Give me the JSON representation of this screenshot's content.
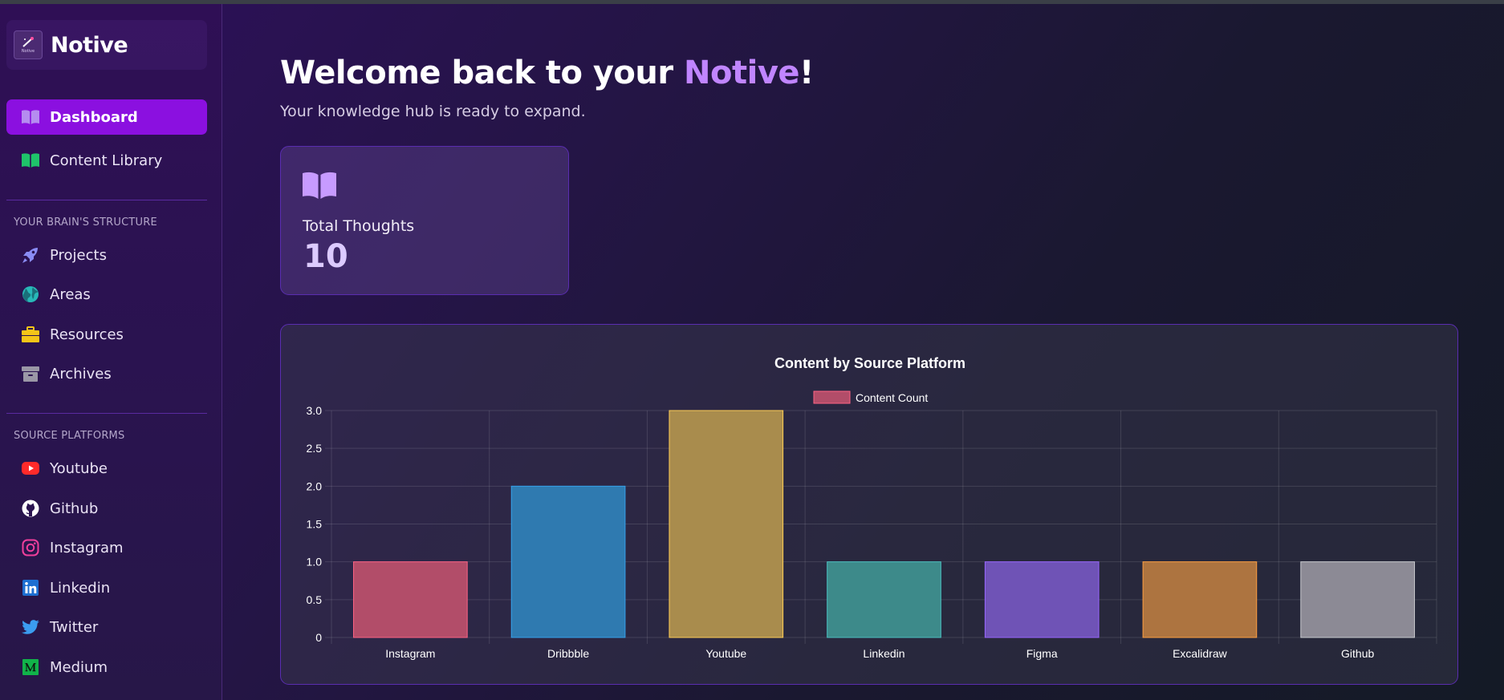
{
  "brand": {
    "name": "Notive",
    "logo_caption": "Notive"
  },
  "nav": {
    "main": [
      {
        "label": "Dashboard",
        "icon": "book-open-icon",
        "active": true
      },
      {
        "label": "Content Library",
        "icon": "book-icon",
        "active": false
      }
    ],
    "structure_label": "YOUR BRAIN'S STRUCTURE",
    "structure": [
      {
        "label": "Projects",
        "icon": "rocket-icon"
      },
      {
        "label": "Areas",
        "icon": "globe-icon"
      },
      {
        "label": "Resources",
        "icon": "briefcase-icon"
      },
      {
        "label": "Archives",
        "icon": "archive-icon"
      }
    ],
    "platforms_label": "SOURCE PLATFORMS",
    "platforms": [
      {
        "label": "Youtube",
        "icon": "youtube-icon"
      },
      {
        "label": "Github",
        "icon": "github-icon"
      },
      {
        "label": "Instagram",
        "icon": "instagram-icon"
      },
      {
        "label": "Linkedin",
        "icon": "linkedin-icon"
      },
      {
        "label": "Twitter",
        "icon": "twitter-icon"
      },
      {
        "label": "Medium",
        "icon": "medium-icon"
      }
    ]
  },
  "header": {
    "welcome_prefix": "Welcome back to your ",
    "welcome_accent": "Notive",
    "welcome_suffix": "!",
    "subtitle": "Your knowledge hub is ready to expand."
  },
  "stats": {
    "total_label": "Total Thoughts",
    "total_value": "10"
  },
  "colors": {
    "accent": "#c085ff",
    "active_nav": "#8b10e0"
  },
  "chart_data": {
    "type": "bar",
    "title": "Content by Source Platform",
    "categories": [
      "Instagram",
      "Dribbble",
      "Youtube",
      "Linkedin",
      "Figma",
      "Excalidraw",
      "Github"
    ],
    "series": [
      {
        "name": "Content Count",
        "values": [
          1,
          2,
          3,
          1,
          1,
          1,
          1
        ]
      }
    ],
    "bar_colors": [
      "#b24d69",
      "#2f7ab0",
      "#a98c4d",
      "#3d8a8a",
      "#6f53b6",
      "#ad7440",
      "#8c8a95"
    ],
    "bar_borders": [
      "#ff6384",
      "#36a2eb",
      "#ffce56",
      "#4bc0c0",
      "#9966ff",
      "#ff9f40",
      "#c9cbcf"
    ],
    "legend_color": "#b24d69",
    "legend_position": "top",
    "y_ticks": [
      "0",
      "0.5",
      "1.0",
      "1.5",
      "2.0",
      "2.5",
      "3.0"
    ],
    "ylim": [
      0,
      3
    ],
    "grid": true
  }
}
